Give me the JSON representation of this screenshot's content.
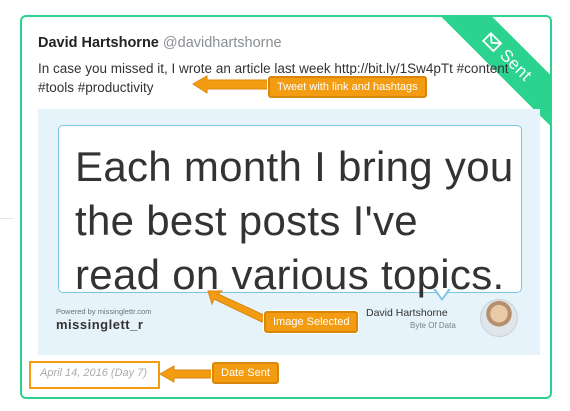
{
  "tweet": {
    "author_name": "David Hartshorne",
    "author_handle": "@davidhartshorne",
    "text_line1": "In case you missed it, I wrote an article last week http://bit.ly/1Sw4pTt #content",
    "text_line2": "#tools #productivity",
    "status": "Sent",
    "date_sent": "April 14, 2016 (Day 7)"
  },
  "preview_image": {
    "quote_lines": [
      "Each month I bring you",
      "the best posts I've",
      "read on various topics."
    ],
    "powered_by": "Powered by missinglettr.com",
    "brand": "missinglett_r",
    "credit_name": "David Hartshorne",
    "credit_subtitle": "Byte Of Data"
  },
  "annotations": {
    "tweet": "Tweet with link and hashtags",
    "image": "Image Selected",
    "date": "Date Sent"
  },
  "colors": {
    "sent_green": "#2bd38f",
    "callout_orange": "#f39c12",
    "preview_bg": "#e6f3fa"
  },
  "icons": {
    "status": "envelope-icon"
  }
}
